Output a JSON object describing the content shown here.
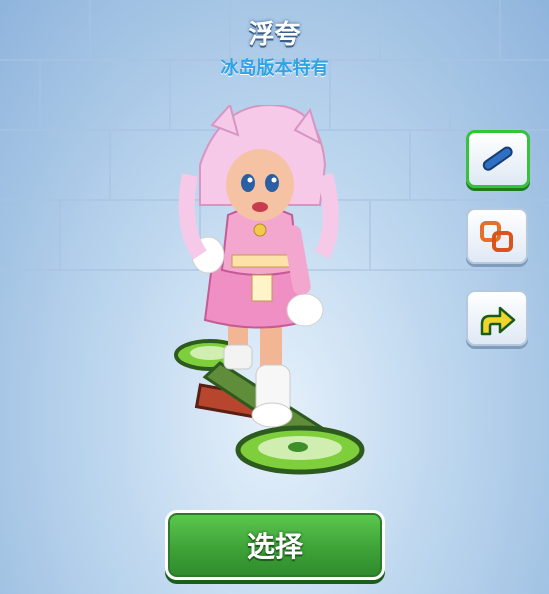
{
  "header": {
    "title": "浮夸",
    "subtitle": "冰岛版本特有"
  },
  "side_buttons": [
    {
      "icon": "hoverboard-icon",
      "selected": true
    },
    {
      "icon": "combo-squares-icon",
      "selected": false
    },
    {
      "icon": "upgrade-arrow-icon",
      "selected": false
    }
  ],
  "select_button": {
    "label": "选择"
  },
  "colors": {
    "title_outline": "#3a5f8a",
    "subtitle": "#2fa3e6",
    "button_green": "#3ea338",
    "selected_border": "#37c23c"
  }
}
